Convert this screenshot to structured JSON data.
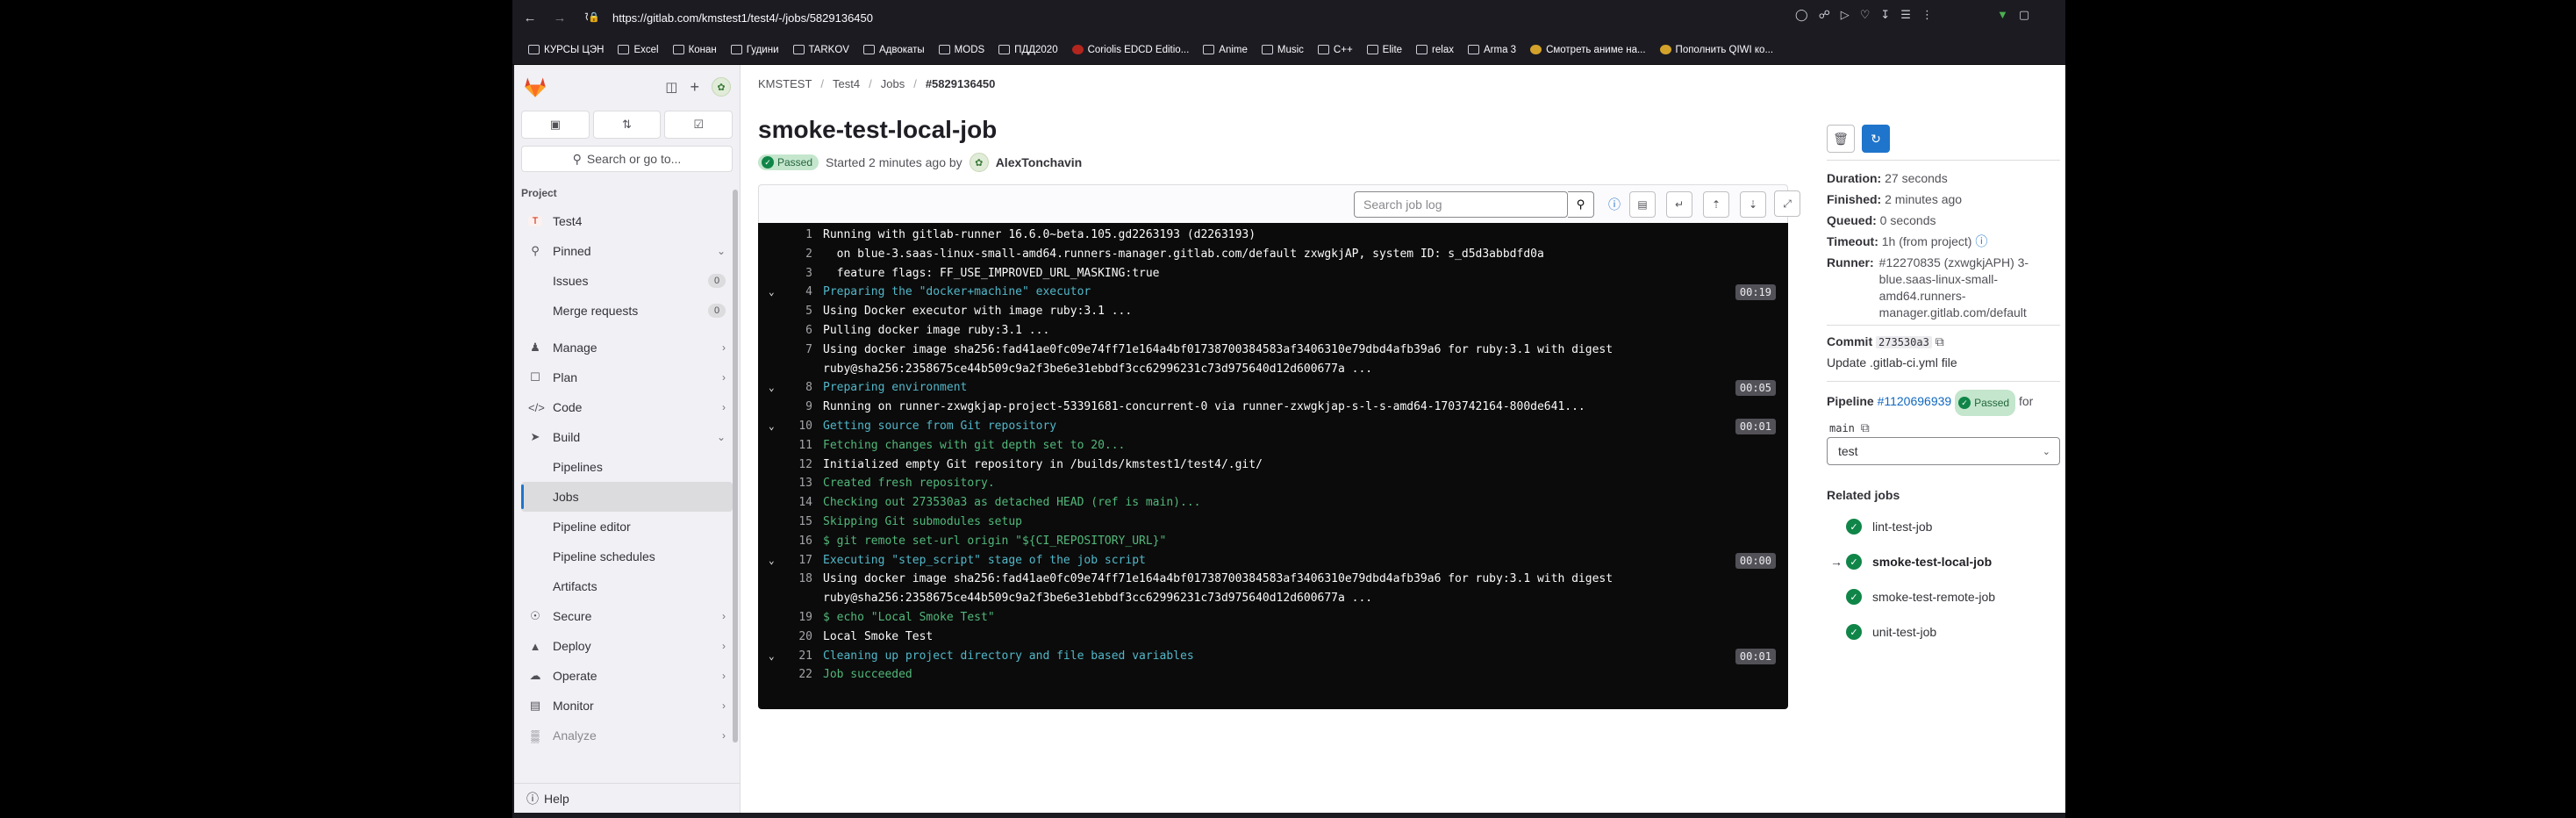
{
  "browser": {
    "url": "https://gitlab.com/kmstest1/test4/-/jobs/5829136450",
    "bookmarks": [
      "КУРСЫ ЦЭН",
      "Excel",
      "Конан",
      "Гудини",
      "TARKOV",
      "Адвокаты",
      "MODS",
      "ПДД2020",
      "Coriolis EDCD Editio...",
      "Anime",
      "Music",
      "C++",
      "Elite",
      "relax",
      "Arma 3",
      "Смотреть аниме на...",
      "Пополнить QIWI ко..."
    ]
  },
  "sidebar": {
    "search_label": "Search or go to...",
    "section_header": "Project",
    "project_initial": "T",
    "project_name": "Test4",
    "pinned": "Pinned",
    "issues": {
      "label": "Issues",
      "count": "0"
    },
    "merge_requests": {
      "label": "Merge requests",
      "count": "0"
    },
    "manage": "Manage",
    "plan": "Plan",
    "code": "Code",
    "build": "Build",
    "build_items": [
      "Pipelines",
      "Jobs",
      "Pipeline editor",
      "Pipeline schedules",
      "Artifacts"
    ],
    "secure": "Secure",
    "deploy": "Deploy",
    "operate": "Operate",
    "monitor": "Monitor",
    "analyze": "Analyze",
    "help": "Help"
  },
  "breadcrumb": [
    "KMSTEST",
    "Test4",
    "Jobs",
    "#5829136450"
  ],
  "job": {
    "title": "smoke-test-local-job",
    "status": "Passed",
    "started": "Started 2 minutes ago by",
    "author": "AlexTonchavin"
  },
  "log_toolbar": {
    "search_placeholder": "Search job log"
  },
  "log_lines": [
    {
      "n": "1",
      "t": "Running with gitlab-runner 16.6.0~beta.105.gd2263193 (d2263193)",
      "c": ""
    },
    {
      "n": "2",
      "t": "  on blue-3.saas-linux-small-amd64.runners-manager.gitlab.com/default zxwgkjAP, system ID: s_d5d3abbdfd0a",
      "c": ""
    },
    {
      "n": "3",
      "t": "  feature flags: FF_USE_IMPROVED_URL_MASKING:true",
      "c": ""
    },
    {
      "n": "4",
      "t": "Preparing the \"docker+machine\" executor",
      "c": "cyan",
      "time": "00:19",
      "tog": true
    },
    {
      "n": "5",
      "t": "Using Docker executor with image ruby:3.1 ...",
      "c": ""
    },
    {
      "n": "6",
      "t": "Pulling docker image ruby:3.1 ...",
      "c": ""
    },
    {
      "n": "7",
      "t": "Using docker image sha256:fad41ae0fc09e74ff71e164a4bf01738700384583af3406310e79dbd4afb39a6 for ruby:3.1 with digest ruby@sha256:2358675ce44b509c9a2f3be6e31ebbdf3cc62996231c73d975640d12d600677a ...",
      "c": "",
      "tall": true
    },
    {
      "n": "8",
      "t": "Preparing environment",
      "c": "cyan",
      "time": "00:05",
      "tog": true
    },
    {
      "n": "9",
      "t": "Running on runner-zxwgkjap-project-53391681-concurrent-0 via runner-zxwgkjap-s-l-s-amd64-1703742164-800de641...",
      "c": ""
    },
    {
      "n": "10",
      "t": "Getting source from Git repository",
      "c": "cyan",
      "time": "00:01",
      "tog": true
    },
    {
      "n": "11",
      "t": "Fetching changes with git depth set to 20...",
      "c": "green"
    },
    {
      "n": "12",
      "t": "Initialized empty Git repository in /builds/kmstest1/test4/.git/",
      "c": ""
    },
    {
      "n": "13",
      "t": "Created fresh repository.",
      "c": "green"
    },
    {
      "n": "14",
      "t": "Checking out 273530a3 as detached HEAD (ref is main)...",
      "c": "green"
    },
    {
      "n": "15",
      "t": "Skipping Git submodules setup",
      "c": "green"
    },
    {
      "n": "16",
      "t": "$ git remote set-url origin \"${CI_REPOSITORY_URL}\"",
      "c": "green"
    },
    {
      "n": "17",
      "t": "Executing \"step_script\" stage of the job script",
      "c": "cyan",
      "time": "00:00",
      "tog": true
    },
    {
      "n": "18",
      "t": "Using docker image sha256:fad41ae0fc09e74ff71e164a4bf01738700384583af3406310e79dbd4afb39a6 for ruby:3.1 with digest ruby@sha256:2358675ce44b509c9a2f3be6e31ebbdf3cc62996231c73d975640d12d600677a ...",
      "c": "",
      "tall": true
    },
    {
      "n": "19",
      "t": "$ echo \"Local Smoke Test\"",
      "c": "green"
    },
    {
      "n": "20",
      "t": "Local Smoke Test",
      "c": ""
    },
    {
      "n": "21",
      "t": "Cleaning up project directory and file based variables",
      "c": "cyan",
      "time": "00:01",
      "tog": true
    },
    {
      "n": "22",
      "t": "Job succeeded",
      "c": "green"
    }
  ],
  "details": {
    "duration_label": "Duration:",
    "duration": "27 seconds",
    "finished_label": "Finished:",
    "finished": "2 minutes ago",
    "queued_label": "Queued:",
    "queued": "0 seconds",
    "timeout_label": "Timeout:",
    "timeout": "1h (from project)",
    "runner_label": "Runner:",
    "runner": "#12270835 (zxwgkjAPH) 3-blue.saas-linux-small-amd64.runners-manager.gitlab.com/default",
    "commit_label": "Commit",
    "commit_sha": "273530a3",
    "commit_msg": "Update .gitlab-ci.yml file",
    "pipeline_label": "Pipeline",
    "pipeline_id": "#1120696939",
    "pipeline_status": "Passed",
    "pipeline_for": "for",
    "pipeline_ref": "main",
    "stage": "test"
  },
  "related": {
    "header": "Related jobs",
    "jobs": [
      "lint-test-job",
      "smoke-test-local-job",
      "smoke-test-remote-job",
      "unit-test-job"
    ]
  },
  "colors": {
    "accent": "#1f75cb",
    "success": "#108548",
    "log_bg": "#0b0b0b",
    "log_green": "#52b87a",
    "log_cyan": "#52b7c9"
  }
}
